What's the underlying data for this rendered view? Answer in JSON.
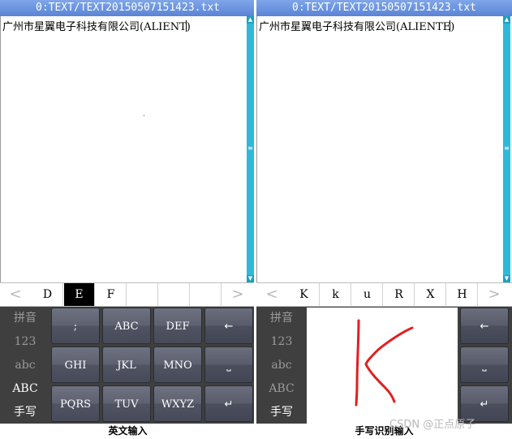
{
  "left": {
    "title": "0:TEXT/TEXT20150507151423.txt",
    "editor_text": "广州市星翼电子科技有限公司(ALIENT",
    "editor_text_after": ")",
    "candidates": {
      "prev": "<",
      "next": ">",
      "items": [
        "D",
        "E",
        "F",
        "",
        "",
        "",
        ""
      ],
      "selected_index": 1
    },
    "modes": [
      {
        "label": "拼音",
        "active": false
      },
      {
        "label": "123",
        "active": false
      },
      {
        "label": "abc",
        "active": false
      },
      {
        "label": "ABC",
        "active": true
      },
      {
        "label": "手写",
        "active": true
      }
    ],
    "keys": [
      ";",
      "ABC",
      "DEF",
      "GHI",
      "JKL",
      "MNO",
      "PQRS",
      "TUV",
      "WXYZ"
    ],
    "status": "英文输入"
  },
  "right": {
    "title": "0:TEXT/TEXT20150507151423.txt",
    "editor_text": "广州市星翼电子科技有限公司(ALIENTE",
    "editor_text_after": ")",
    "candidates": {
      "prev": "<",
      "next": ">",
      "items": [
        "K",
        "k",
        "u",
        "R",
        "X",
        "H"
      ]
    },
    "modes": [
      {
        "label": "拼音",
        "active": false
      },
      {
        "label": "123",
        "active": false
      },
      {
        "label": "abc",
        "active": false
      },
      {
        "label": "ABC",
        "active": false
      },
      {
        "label": "手写",
        "active": true
      }
    ],
    "handwriting_stroke_color": "#e02020",
    "status": "手写识别输入"
  },
  "icons": {
    "backspace": "backspace-icon",
    "space": "space-icon",
    "enter": "enter-icon",
    "scroll_up": "scroll-up-icon",
    "scroll_down": "scroll-down-icon",
    "scroll_thumb": "scroll-thumb-icon"
  },
  "watermark": "CSDN @正点原子",
  "colors": {
    "titlebar": "#6a93e0",
    "scrollbar": "#2fb9d9",
    "keyboard_bg": "#3f3f3f",
    "selected_candidate": "#000000"
  }
}
